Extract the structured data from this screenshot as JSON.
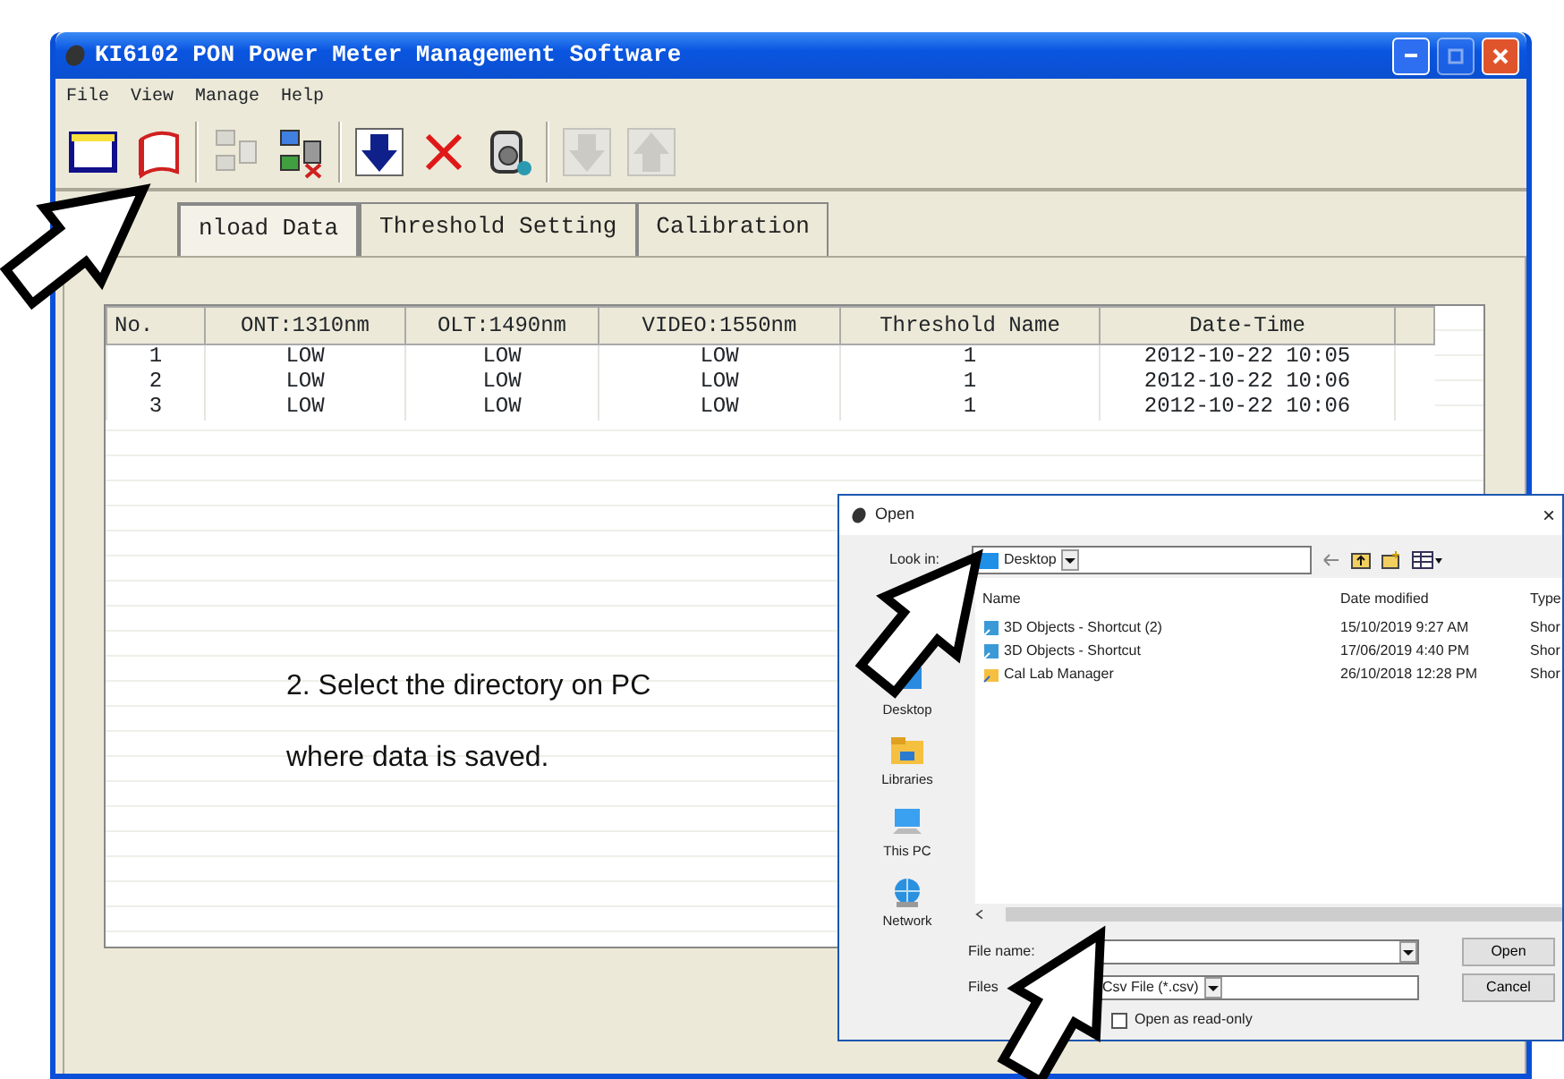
{
  "window": {
    "title": "KI6102 PON Power Meter Management Software"
  },
  "menu": [
    "File",
    "View",
    "Manage",
    "Help"
  ],
  "toolbar": [
    {
      "kind": "window",
      "disabled": false
    },
    {
      "kind": "notebook",
      "disabled": false
    },
    {
      "kind": "computers",
      "disabled": true
    },
    {
      "kind": "computer-remove",
      "disabled": false
    },
    {
      "kind": "download",
      "disabled": false
    },
    {
      "kind": "delete",
      "disabled": false
    },
    {
      "kind": "printer",
      "disabled": false
    },
    {
      "kind": "arrow-down",
      "disabled": true
    },
    {
      "kind": "arrow-up",
      "disabled": true
    }
  ],
  "tabs": [
    {
      "label": "nload Data",
      "selected": true
    },
    {
      "label": "Threshold Setting",
      "selected": false
    },
    {
      "label": "Calibration",
      "selected": false
    }
  ],
  "table": {
    "columns": [
      "No.",
      "ONT:1310nm",
      "OLT:1490nm",
      "VIDEO:1550nm",
      "Threshold Name",
      "Date-Time"
    ],
    "rows": [
      [
        "1",
        "LOW",
        "LOW",
        "LOW",
        "1",
        "2012-10-22 10:05"
      ],
      [
        "2",
        "LOW",
        "LOW",
        "LOW",
        "1",
        "2012-10-22 10:06"
      ],
      [
        "3",
        "LOW",
        "LOW",
        "LOW",
        "1",
        "2012-10-22 10:06"
      ]
    ]
  },
  "annotation": "2. Select the directory on PC where data is saved.",
  "dialog": {
    "title": "Open",
    "close": "×",
    "look_in_label": "Look in:",
    "look_in_value": "Desktop",
    "places": [
      {
        "label": "Desktop",
        "kind": "desktop"
      },
      {
        "label": "Libraries",
        "kind": "libraries"
      },
      {
        "label": "This PC",
        "kind": "pc"
      },
      {
        "label": "Network",
        "kind": "network"
      }
    ],
    "columns": [
      "Name",
      "Date modified",
      "Type"
    ],
    "files": [
      {
        "name": "3D Objects - Shortcut (2)",
        "date": "15/10/2019 9:27 AM",
        "type": "Shor",
        "kind": "objects"
      },
      {
        "name": "3D Objects - Shortcut",
        "date": "17/06/2019 4:40 PM",
        "type": "Shor",
        "kind": "objects"
      },
      {
        "name": "Cal Lab Manager",
        "date": "26/10/2018 12:28 PM",
        "type": "Shor",
        "kind": "folder"
      }
    ],
    "file_name_label": "File name:",
    "file_type_label": "Files",
    "file_type_value": "Csv File (*.csv)",
    "read_only": {
      "label": "Open as read-only",
      "checked": false
    },
    "buttons": [
      "Open",
      "Cancel"
    ]
  }
}
